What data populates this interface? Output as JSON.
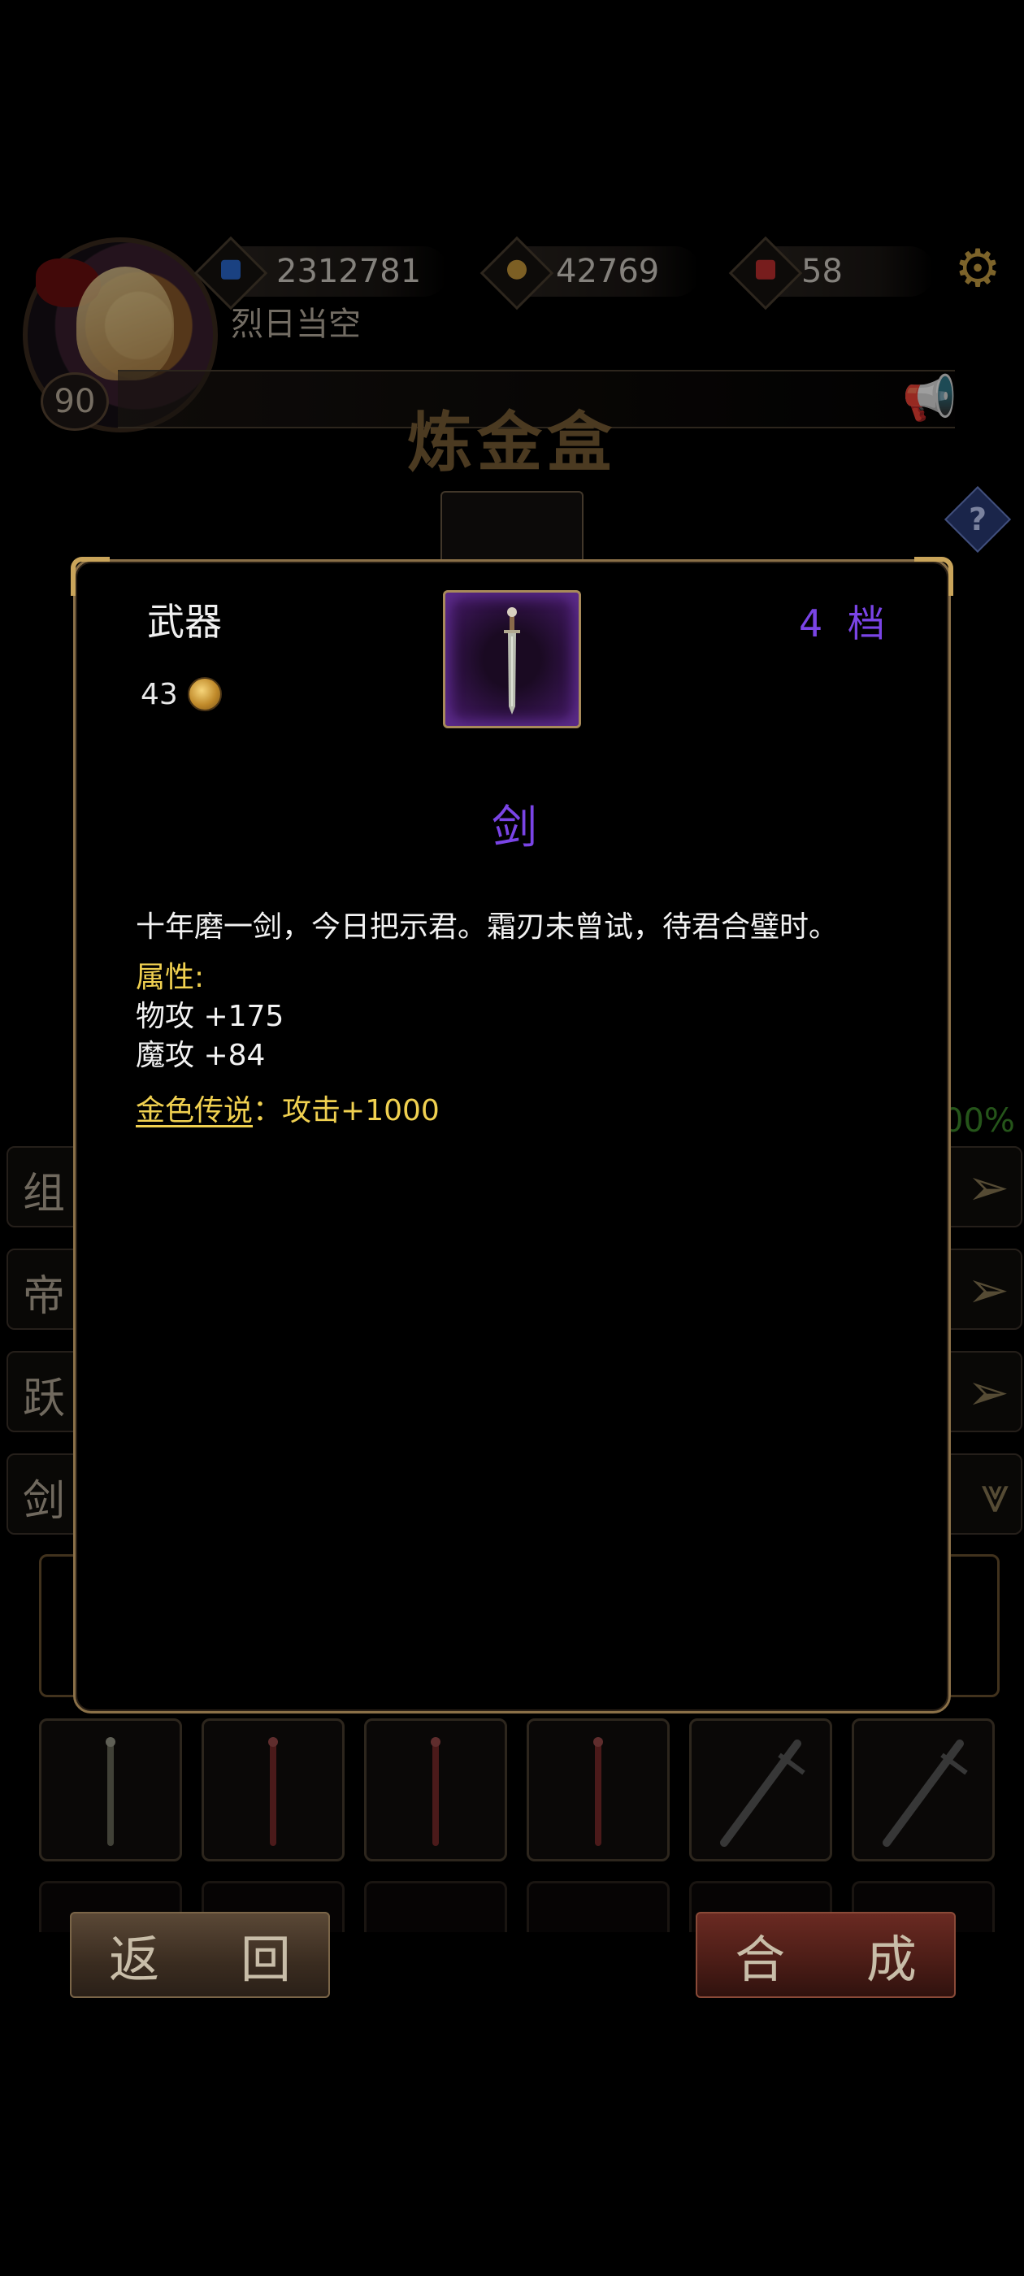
{
  "header": {
    "resources": [
      {
        "name": "blue-gem",
        "value": "2312781",
        "color": "#2a6ad0"
      },
      {
        "name": "gold-coin",
        "value": "42769",
        "color": "#c99a3a"
      },
      {
        "name": "red-crystal",
        "value": "58",
        "color": "#c03030"
      }
    ],
    "player_name": "烈日当空",
    "player_level": "90",
    "page_title": "炼金盒",
    "icons": {
      "settings": "gear-icon",
      "notice": "horn-icon",
      "help": "help-icon"
    }
  },
  "background_rows": [
    {
      "label": "组",
      "arrow": "right-arrow-icon"
    },
    {
      "label": "帝",
      "arrow": "right-arrow-icon"
    },
    {
      "label": "跃",
      "arrow": "right-arrow-icon"
    },
    {
      "label": "剑",
      "arrow": "down-arrow-icon"
    }
  ],
  "background_percent": "00%",
  "inventory": [
    {
      "type": "sword",
      "color": "#6a6a5a"
    },
    {
      "type": "sword",
      "color": "#7a2a2a"
    },
    {
      "type": "sword",
      "color": "#7a2a2a"
    },
    {
      "type": "sword",
      "color": "#7a2a2a"
    },
    {
      "type": "greatsword",
      "color": "#5a5a5a"
    },
    {
      "type": "greatsword",
      "color": "#5a5a5a"
    }
  ],
  "buttons": {
    "back": "返 回",
    "craft": "合 成"
  },
  "popup": {
    "category": "武器",
    "price": "43",
    "tier": "4 档",
    "name": "剑",
    "description": "十年磨一剑，今日把示君。霜刃未曾试，待君合璧时。",
    "attributes_title": "属性:",
    "attributes": [
      "物攻 +175",
      "魔攻 +84"
    ],
    "legend_label": "金色传说",
    "legend_sep": "：",
    "legend_value": "攻击+1000",
    "rarity_color": "#7a44e6"
  }
}
